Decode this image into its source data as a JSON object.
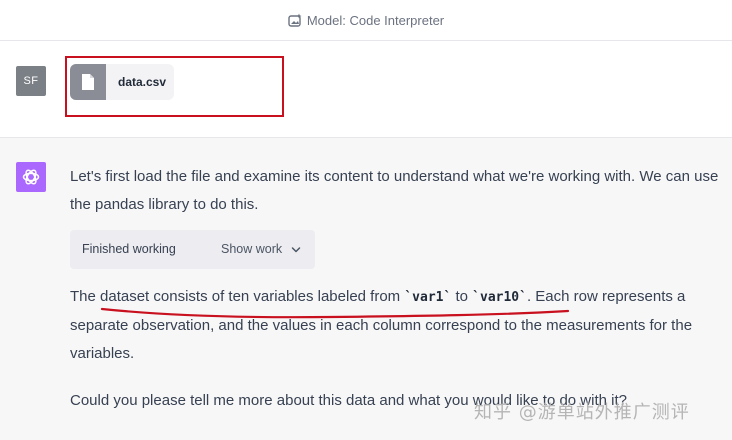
{
  "header": {
    "model_label": "Model: Code Interpreter",
    "model_icon": "sparkle-image-icon"
  },
  "user_message": {
    "avatar_initials": "SF",
    "attachment": {
      "file_name": "data.csv",
      "icon": "file-icon"
    },
    "highlight_color": "#c8101e"
  },
  "assistant_message": {
    "avatar_icon": "openai-logo-icon",
    "avatar_color": "#ab68ff",
    "paragraph1": "Let's first load the file and examine its content to understand what we're working with. We can use the pandas library to do this.",
    "working": {
      "status": "Finished working",
      "show_label": "Show work"
    },
    "paragraph2": {
      "part1": "The dataset consists of ten variables labeled from ",
      "code1": "`var1`",
      "part2": " to ",
      "code2": "`var10`",
      "part3": ". Each row represents a separate observation, and the values in each column correspond to the measurements for the variables."
    },
    "paragraph3": "Could you please tell me more about this data and what you would like to do with it?"
  },
  "watermark": "知乎 @游单站外推广测评"
}
